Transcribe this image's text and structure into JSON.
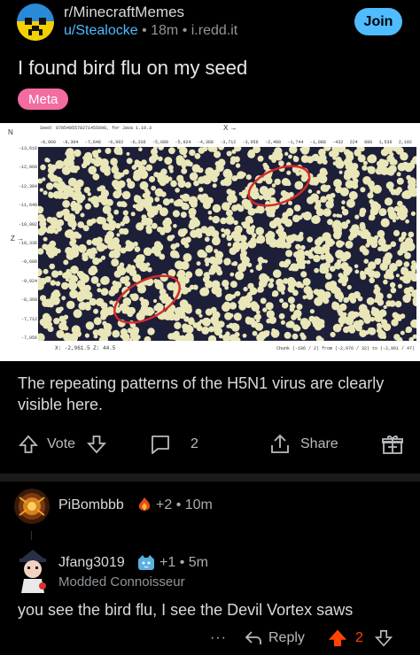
{
  "post": {
    "subreddit": "r/MinecraftMemes",
    "author": "u/Stealocke",
    "age": "18m",
    "domain": "i.redd.it",
    "join_label": "Join",
    "title": "I found bird flu on my seed",
    "flair": "Meta",
    "caption": "The repeating patterns of the H5N1 virus are clearly visible here.",
    "vote_label": "Vote",
    "comment_count": "2",
    "share_label": "Share"
  },
  "image": {
    "seed_line": "Seed: 8705495578271455098, for Java 1.19.3",
    "x_axis_label": "X →",
    "north_label": "N",
    "z_axis_label": "Z →",
    "x_ticks": [
      "-8,960",
      "-8,304",
      "-7,648",
      "-6,992",
      "-6,336",
      "-5,680",
      "-5,024",
      "-4,368",
      "-3,712",
      "-3,056",
      "-2,400",
      "-1,744",
      "-1,088",
      "-432",
      "224",
      "880",
      "1,536",
      "2,192"
    ],
    "z_ticks": [
      "-13,616",
      "-12,960",
      "-12,304",
      "-11,648",
      "-10,992",
      "-10,336",
      "-9,680",
      "-9,024",
      "-8,368",
      "-7,712",
      "-7,056"
    ],
    "coords": "X: -2,961.5   Z: 44.5",
    "chunk_info": "Chunk (-186 / 2) from (-2,976 / 32) to (-2,961 / 47)",
    "colors": {
      "background": "#1d1e38",
      "blob": "#e9e6b8",
      "circle": "#d42b2b"
    }
  },
  "comments": [
    {
      "author": "PiBombbb",
      "flair_icon": "fire-gem-icon",
      "extra": "+2",
      "age": "10m"
    },
    {
      "author": "Jfang3019",
      "flair_icon": "cat-emoji-icon",
      "extra": "+1",
      "age": "5m",
      "user_flair": "Modded Connoisseur",
      "text": "you see the bird flu, I see the Devil Vortex saws",
      "more_label": "···",
      "reply_label": "Reply",
      "score": "2"
    }
  ],
  "colors": {
    "accent": "#4fbcff",
    "flair": "#f46ba1",
    "upvote": "#ff4500"
  }
}
